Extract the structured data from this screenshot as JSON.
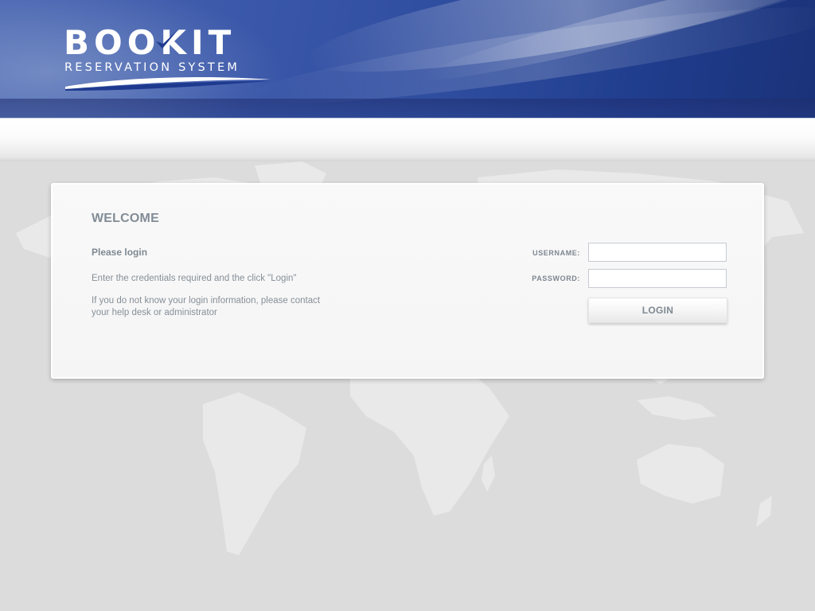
{
  "header": {
    "logo_title": "BOOKIT",
    "logo_subtitle": "RESERVATION SYSTEM",
    "brand_color": "#2f4d9f"
  },
  "login": {
    "welcome": "WELCOME",
    "please_login": "Please login",
    "instructions": "Enter the credentials required and the click \"Login\"",
    "help_text": "If you do not know your login information, please contact your help desk or administrator",
    "username_label": "USERNAME:",
    "username_value": "",
    "password_label": "PASSWORD:",
    "password_value": "",
    "login_button": "LOGIN"
  },
  "icons": {
    "logo_check": "checkmark-icon",
    "logo_swoosh": "swoosh-icon",
    "background": "world-map"
  }
}
